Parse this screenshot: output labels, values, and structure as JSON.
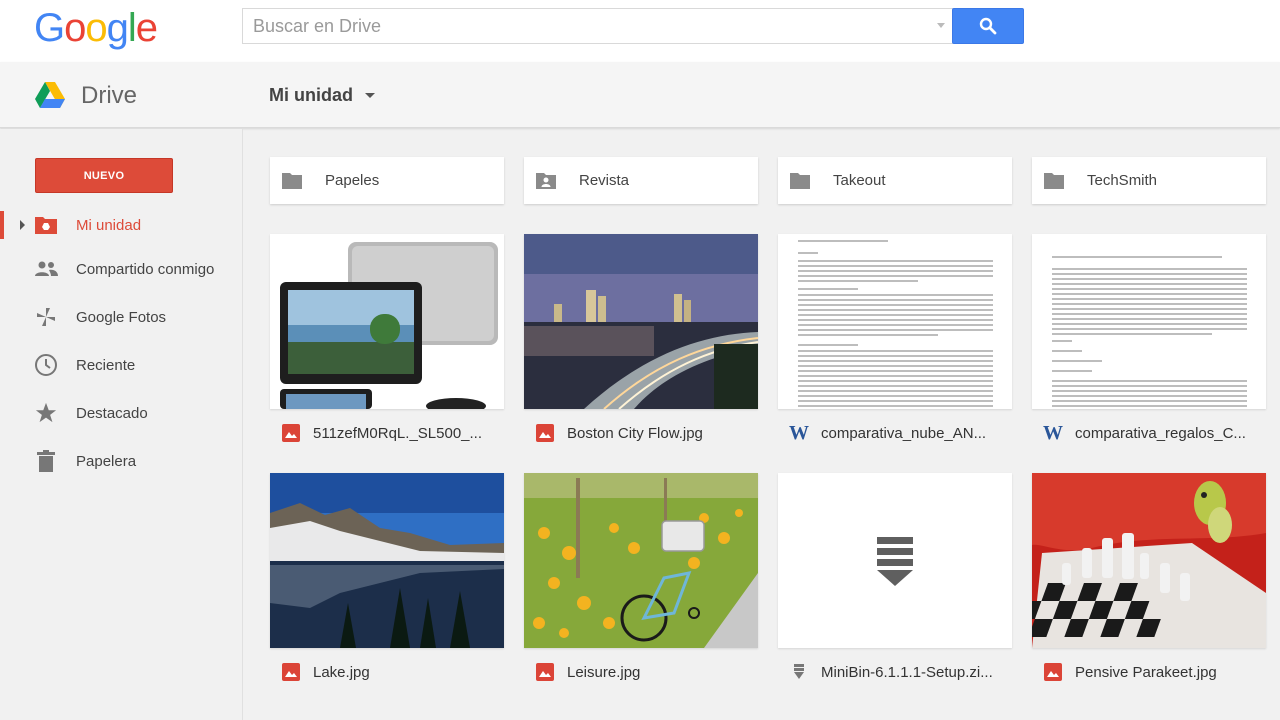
{
  "header": {
    "logo_letters": [
      {
        "char": "G",
        "color": "#4285f4"
      },
      {
        "char": "o",
        "color": "#ea4335"
      },
      {
        "char": "o",
        "color": "#fbbc05"
      },
      {
        "char": "g",
        "color": "#4285f4"
      },
      {
        "char": "l",
        "color": "#34a853"
      },
      {
        "char": "e",
        "color": "#ea4335"
      }
    ],
    "search_placeholder": "Buscar en Drive",
    "search_button_icon": "search-icon"
  },
  "subheader": {
    "app_name": "Drive",
    "location_label": "Mi unidad"
  },
  "sidebar": {
    "new_button": "NUEVO",
    "items": [
      {
        "label": "Mi unidad",
        "icon": "my-drive-icon",
        "active": true
      },
      {
        "label": "Compartido conmigo",
        "icon": "shared-people-icon",
        "active": false
      },
      {
        "label": "Google Fotos",
        "icon": "photos-pinwheel-icon",
        "active": false
      },
      {
        "label": "Reciente",
        "icon": "clock-icon",
        "active": false
      },
      {
        "label": "Destacado",
        "icon": "star-icon",
        "active": false
      },
      {
        "label": "Papelera",
        "icon": "trash-icon",
        "active": false
      }
    ]
  },
  "folders": [
    {
      "name": "Papeles",
      "icon": "folder-icon"
    },
    {
      "name": "Revista",
      "icon": "shared-folder-icon"
    },
    {
      "name": "Takeout",
      "icon": "folder-icon"
    },
    {
      "name": "TechSmith",
      "icon": "folder-icon"
    }
  ],
  "files": [
    {
      "name": "511zefM0RqL._SL500_...",
      "type": "image",
      "type_icon": "image-file-icon"
    },
    {
      "name": "Boston City Flow.jpg",
      "type": "image",
      "type_icon": "image-file-icon"
    },
    {
      "name": "comparativa_nube_AN...",
      "type": "word",
      "type_icon": "word-doc-icon",
      "type_glyph": "W"
    },
    {
      "name": "comparativa_regalos_C...",
      "type": "word",
      "type_icon": "word-doc-icon",
      "type_glyph": "W"
    },
    {
      "name": "Lake.jpg",
      "type": "image",
      "type_icon": "image-file-icon"
    },
    {
      "name": "Leisure.jpg",
      "type": "image",
      "type_icon": "image-file-icon"
    },
    {
      "name": "MiniBin-6.1.1.1-Setup.zi...",
      "type": "archive",
      "type_icon": "archive-file-icon"
    },
    {
      "name": "Pensive Parakeet.jpg",
      "type": "image",
      "type_icon": "image-file-icon"
    }
  ],
  "colors": {
    "accent_red": "#dd4b39",
    "search_blue": "#4285f4",
    "word_blue": "#2a5699"
  }
}
